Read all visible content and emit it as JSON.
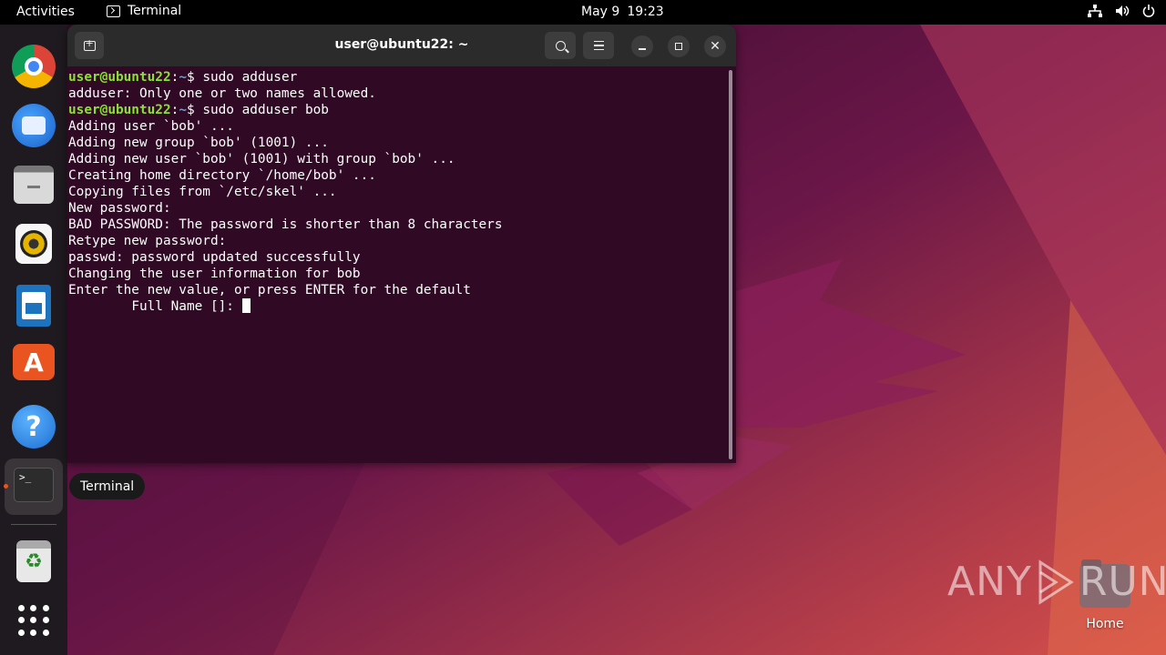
{
  "topbar": {
    "activities": "Activities",
    "app_name": "Terminal",
    "date": "May 9",
    "time": "19:23",
    "tray_icons": [
      "network-icon",
      "volume-icon",
      "power-icon"
    ]
  },
  "dock": {
    "items": [
      {
        "name": "Google Chrome",
        "icon": "chrome-icon"
      },
      {
        "name": "Thunderbird Mail",
        "icon": "thunderbird-icon"
      },
      {
        "name": "Files",
        "icon": "files-icon"
      },
      {
        "name": "Rhythmbox",
        "icon": "rhythmbox-icon"
      },
      {
        "name": "LibreOffice Writer",
        "icon": "writer-icon"
      },
      {
        "name": "Ubuntu Software",
        "icon": "software-icon"
      },
      {
        "name": "Help",
        "icon": "help-icon"
      },
      {
        "name": "Terminal",
        "icon": "terminal-icon",
        "running": true
      },
      {
        "name": "Trash",
        "icon": "trash-icon"
      },
      {
        "name": "Show Applications",
        "icon": "app-grid-icon"
      }
    ],
    "terminal_glyph": ">_",
    "tooltip": "Terminal"
  },
  "terminal": {
    "title": "user@ubuntu22: ~",
    "prompt": {
      "user": "user@ubuntu22",
      "sep": ":",
      "path": "~",
      "symbol": "$ "
    },
    "lines": [
      {
        "prompt": true,
        "text": "sudo adduser"
      },
      {
        "prompt": false,
        "text": "adduser: Only one or two names allowed."
      },
      {
        "prompt": true,
        "text": "sudo adduser bob"
      },
      {
        "prompt": false,
        "text": "Adding user `bob' ..."
      },
      {
        "prompt": false,
        "text": "Adding new group `bob' (1001) ..."
      },
      {
        "prompt": false,
        "text": "Adding new user `bob' (1001) with group `bob' ..."
      },
      {
        "prompt": false,
        "text": "Creating home directory `/home/bob' ..."
      },
      {
        "prompt": false,
        "text": "Copying files from `/etc/skel' ..."
      },
      {
        "prompt": false,
        "text": "New password:"
      },
      {
        "prompt": false,
        "text": "BAD PASSWORD: The password is shorter than 8 characters"
      },
      {
        "prompt": false,
        "text": "Retype new password:"
      },
      {
        "prompt": false,
        "text": "passwd: password updated successfully"
      },
      {
        "prompt": false,
        "text": "Changing the user information for bob"
      },
      {
        "prompt": false,
        "text": "Enter the new value, or press ENTER for the default"
      },
      {
        "prompt": false,
        "text": "\tFull Name []: ",
        "cursor": true
      }
    ],
    "colors": {
      "background": "#300a24",
      "prompt_user": "#8ae234",
      "prompt_path": "#729fcf"
    }
  },
  "desktop": {
    "home_label": "Home",
    "watermark": {
      "left": "ANY",
      "right": "RUN"
    }
  }
}
